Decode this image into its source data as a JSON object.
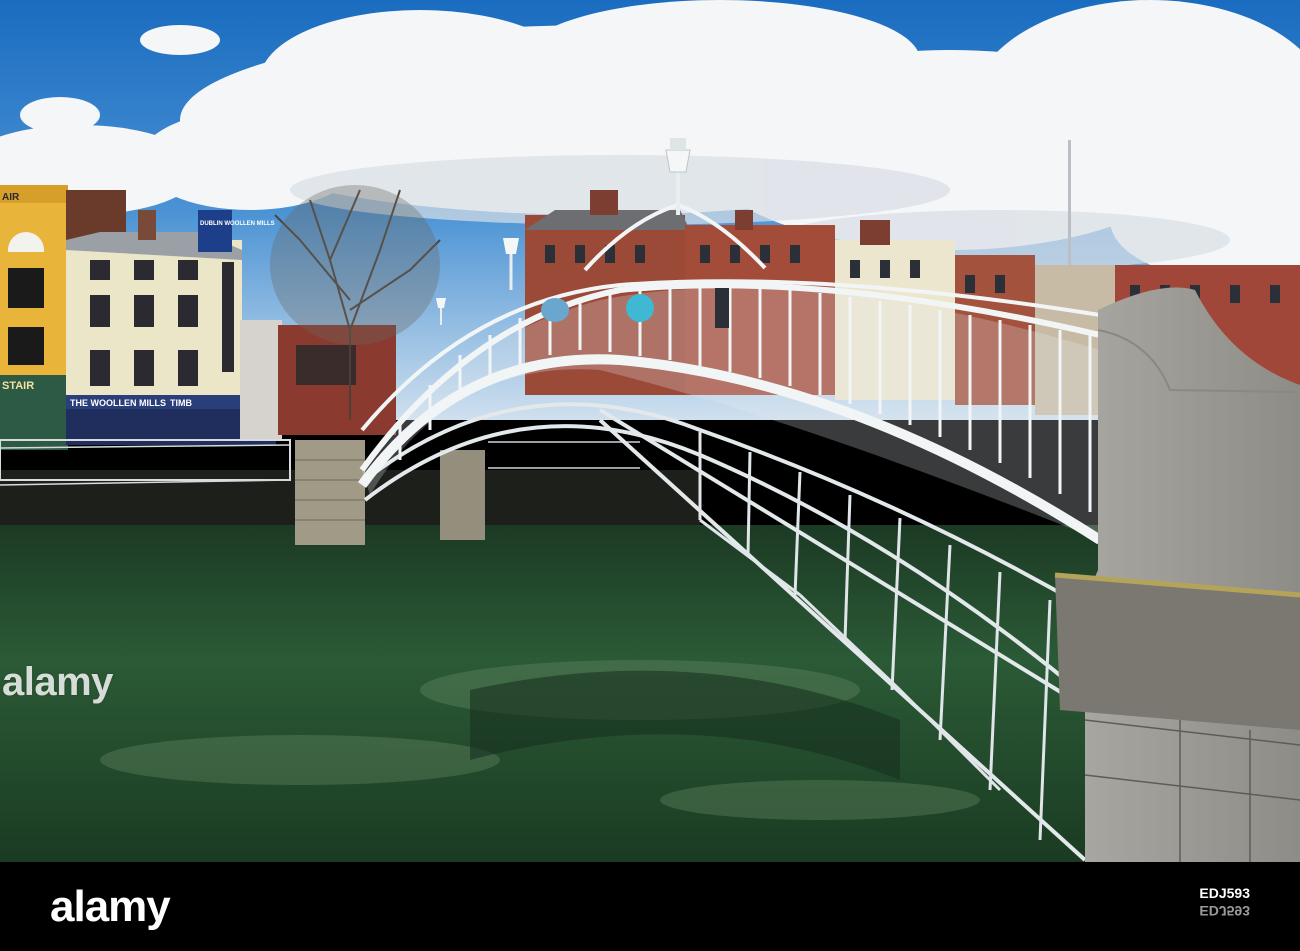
{
  "photo": {
    "watermark_mid": "alamy",
    "signs": {
      "shop_top": "AIR",
      "shop_front": "STAIR",
      "woollen_mills_fascia": "THE WOOLLEN MILLS",
      "woollen_mills_fascia_2": "TIMB",
      "rooftop_sign": "DUBLIN WOOLLEN MILLS"
    }
  },
  "footer": {
    "logo": "alamy",
    "image_id": "EDJ593",
    "image_id_mirror": "EDJ593"
  },
  "colors": {
    "sky_top": "#1e72c2",
    "river": "#1f4a2c",
    "bridge": "#e9eef0"
  }
}
